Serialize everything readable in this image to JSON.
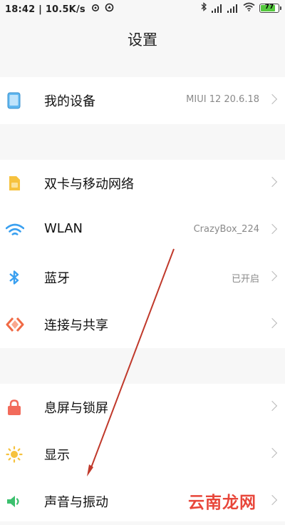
{
  "status_bar": {
    "time": "18:42",
    "net_speed": "10.5K/s",
    "battery_level": "77",
    "icons": [
      "sync-icon",
      "location-icon",
      "bluetooth-icon",
      "signal-icon",
      "signal-icon",
      "wifi-icon",
      "battery-icon"
    ]
  },
  "header": {
    "title": "设置"
  },
  "groups": [
    {
      "items": [
        {
          "label": "我的设备",
          "value": "MIUI 12 20.6.18",
          "icon": "device-icon",
          "color": "#5fb7f0"
        }
      ]
    },
    {
      "items": [
        {
          "label": "双卡与移动网络",
          "value": "",
          "icon": "sim-card-icon",
          "color": "#f6c23e"
        },
        {
          "label": "WLAN",
          "value": "CrazyBox_224",
          "icon": "wifi-icon",
          "color": "#3aa0f0"
        },
        {
          "label": "蓝牙",
          "value": "已开启",
          "icon": "bluetooth-icon",
          "color": "#3aa0f0"
        },
        {
          "label": "连接与共享",
          "value": "",
          "icon": "share-icon",
          "color": "#f06a45"
        }
      ]
    },
    {
      "items": [
        {
          "label": "息屏与锁屏",
          "value": "",
          "icon": "lock-icon",
          "color": "#f26b5b"
        },
        {
          "label": "显示",
          "value": "",
          "icon": "brightness-icon",
          "color": "#f6c23e"
        },
        {
          "label": "声音与振动",
          "value": "",
          "icon": "speaker-icon",
          "color": "#3cc06e"
        }
      ]
    }
  ],
  "annotation": {
    "arrow_color": "#c0392b"
  },
  "watermark": "云南龙网"
}
